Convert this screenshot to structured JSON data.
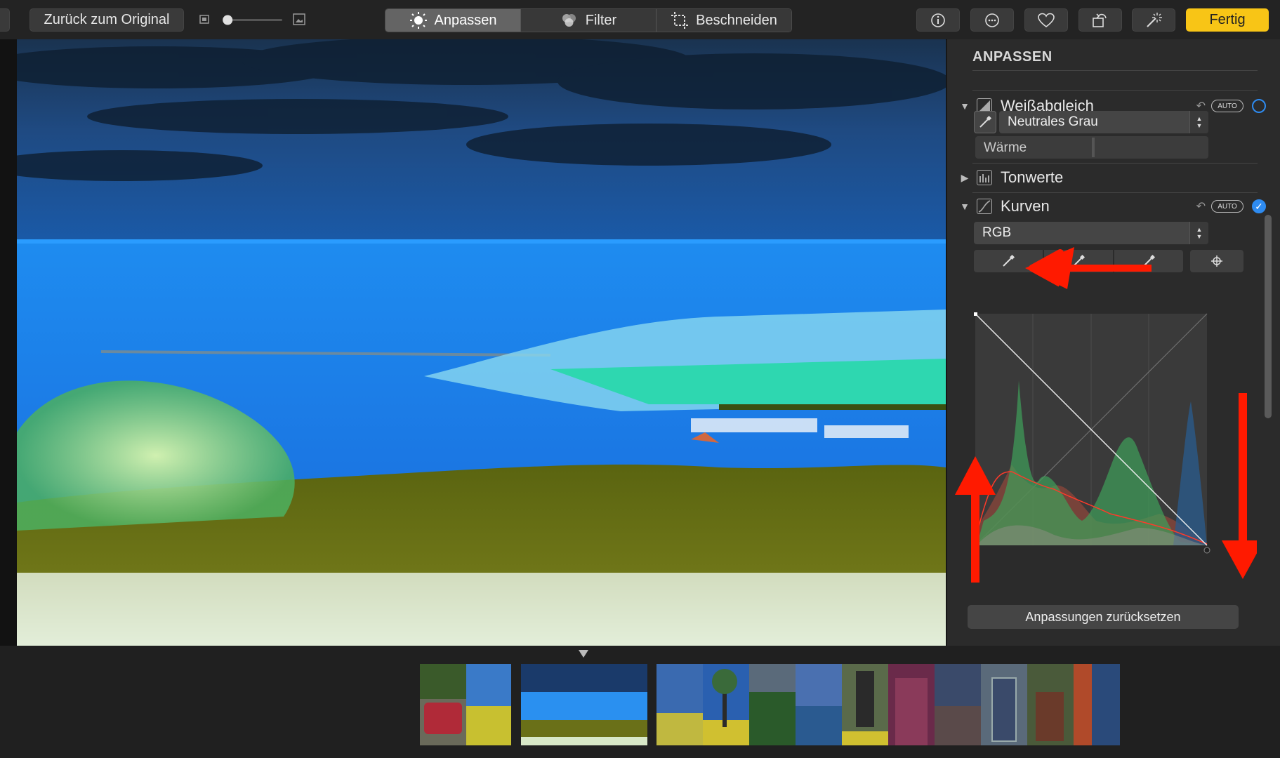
{
  "toolbar": {
    "back_label": "Zurück zum Original",
    "segments": [
      {
        "label": "Anpassen",
        "icon": "sun-adjust-icon"
      },
      {
        "label": "Filter",
        "icon": "filter-circles-icon"
      },
      {
        "label": "Beschneiden",
        "icon": "crop-icon"
      }
    ],
    "active_segment": "Anpassen",
    "done_label": "Fertig",
    "zoom_level": 0.05,
    "icons": [
      "info-icon",
      "more-icon",
      "favorite-heart-icon",
      "rotate-icon",
      "magic-wand-icon"
    ]
  },
  "panel": {
    "title": "ANPASSEN",
    "white_balance": {
      "label": "Weißabgleich",
      "auto_label": "AUTO",
      "preset": "Neutrales Grau",
      "slider_label": "Wärme",
      "slider_value": 0.5,
      "enabled": false
    },
    "levels": {
      "label": "Tonwerte"
    },
    "curves": {
      "label": "Kurven",
      "auto_label": "AUTO",
      "channel": "RGB",
      "enabled": true
    },
    "reset_label": "Anpassungen zurücksetzen"
  },
  "colors": {
    "accent_yellow": "#f8c516",
    "checkbox_blue": "#2e8bf0",
    "annotation_red": "#ff1a00"
  }
}
